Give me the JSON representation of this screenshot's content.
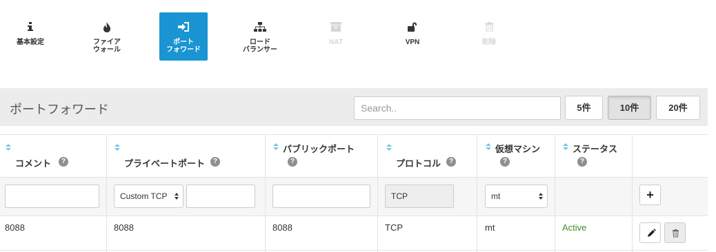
{
  "toolbar": {
    "items": [
      {
        "id": "basic",
        "label": "基本設定",
        "icon": "info-icon",
        "state": "normal"
      },
      {
        "id": "firewall",
        "label_lines": [
          "ファイア",
          "ウォール"
        ],
        "icon": "fire-icon",
        "state": "normal"
      },
      {
        "id": "portforward",
        "label_lines": [
          "ポート",
          "フォワード"
        ],
        "icon": "sign-in-icon",
        "state": "active"
      },
      {
        "id": "loadbalancer",
        "label_lines": [
          "ロード",
          "バランサー"
        ],
        "icon": "sitemap-icon",
        "state": "normal"
      },
      {
        "id": "nat",
        "label": "NAT",
        "icon": "archive-icon",
        "state": "disabled"
      },
      {
        "id": "vpn",
        "label": "VPN",
        "icon": "unlock-icon",
        "state": "normal"
      },
      {
        "id": "delete",
        "label": "削除",
        "icon": "trash-icon",
        "state": "disabled"
      }
    ]
  },
  "header": {
    "title": "ポートフォワード",
    "search_placeholder": "Search..",
    "page_sizes": [
      {
        "label": "5件",
        "active": false
      },
      {
        "label": "10件",
        "active": true
      },
      {
        "label": "20件",
        "active": false
      }
    ]
  },
  "table": {
    "columns": [
      {
        "label": "コメント"
      },
      {
        "label": "プライベートポート"
      },
      {
        "label": "パブリックポート"
      },
      {
        "label": "プロトコル"
      },
      {
        "label": "仮想マシン"
      },
      {
        "label": "ステータス"
      }
    ],
    "filter": {
      "protocol_select": "Custom TCP",
      "protocol_value": "TCP",
      "vm_select": "mt",
      "add_symbol": "+"
    },
    "rows": [
      {
        "comment": "8088",
        "private_port": "8088",
        "public_port": "8088",
        "protocol": "TCP",
        "vm": "mt",
        "status": "Active"
      }
    ]
  },
  "colors": {
    "accent": "#1a94d2",
    "status_active": "#3d8f2a",
    "header_bg": "#ececec"
  }
}
